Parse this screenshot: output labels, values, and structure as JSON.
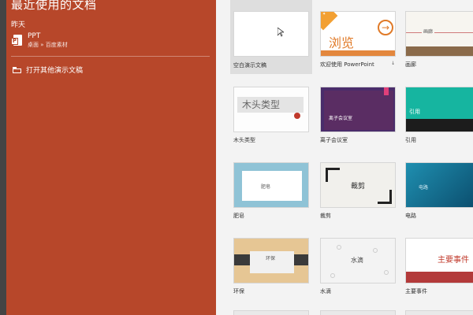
{
  "sidebar": {
    "title": "最近使用的文档",
    "section_label": "昨天",
    "recent": {
      "name": "PPT",
      "path": "桌面 » 百度素材",
      "icon": "ppt-file-icon"
    },
    "open_other_label": "打开其他演示文稿",
    "open_other_icon": "folder-open-icon",
    "background": "#b7472a"
  },
  "templates": [
    {
      "caption": "空白演示文稿"
    },
    {
      "caption": "欢迎使用 PowerPoint",
      "thumb_text": "浏览",
      "ribbon_text": "✦",
      "badge": "↓"
    },
    {
      "caption": "画廊",
      "thumb_text": "画廊"
    },
    {
      "caption": "木头类型",
      "thumb_text": "木头类型"
    },
    {
      "caption": "离子会议室",
      "thumb_text": "离子会议室"
    },
    {
      "caption": "引用",
      "thumb_text": "引用"
    },
    {
      "caption": "肥皂",
      "thumb_text": "肥皂"
    },
    {
      "caption": "裁剪",
      "thumb_text": "裁剪"
    },
    {
      "caption": "电路",
      "thumb_text": "电路"
    },
    {
      "caption": "环保",
      "thumb_text": "环保"
    },
    {
      "caption": "水滴",
      "thumb_text": "水滴"
    },
    {
      "caption": "主要事件",
      "thumb_text": "主要事件"
    }
  ]
}
